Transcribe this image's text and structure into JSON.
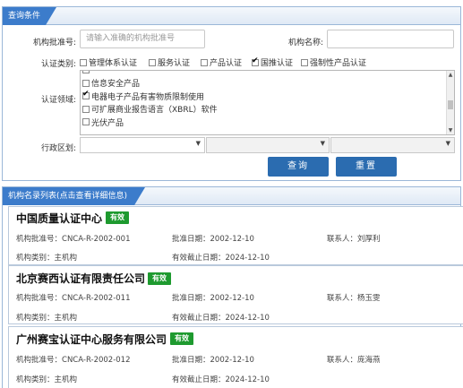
{
  "query_panel": {
    "title": "查询条件",
    "approval_no_label": "机构批准号:",
    "approval_no_placeholder": "请输入准确的机构批准号",
    "org_name_label": "机构名称:",
    "org_name_value": "",
    "cert_type_label": "认证类别:",
    "cert_types": [
      {
        "label": "管理体系认证",
        "checked": false
      },
      {
        "label": "服务认证",
        "checked": false
      },
      {
        "label": "产品认证",
        "checked": false
      },
      {
        "label": "国推认证",
        "checked": true
      },
      {
        "label": "强制性产品认证",
        "checked": false
      }
    ],
    "cert_field_label": "认证领域:",
    "cert_fields": [
      {
        "label": "信息安全产品",
        "checked": false
      },
      {
        "label": "电器电子产品有害物质限制使用",
        "checked": true
      },
      {
        "label": "可扩展商业报告语言（XBRL）软件",
        "checked": false
      },
      {
        "label": "光伏产品",
        "checked": false
      }
    ],
    "region_label": "行政区划:",
    "query_button": "查询",
    "reset_button": "重置"
  },
  "list_panel": {
    "title": "机构名录列表(点击查看详细信息)",
    "approval_no_prefix": "机构批准号：",
    "approval_date_prefix": "批准日期：",
    "contact_prefix": "联系人：",
    "org_type_prefix": "机构类别：",
    "valid_until_prefix": "有效截止日期：",
    "orgs": [
      {
        "name": "中国质量认证中心",
        "status": "有效",
        "approval_no": "CNCA-R-2002-001",
        "approval_date": "2002-12-10",
        "contact": "刘厚利",
        "org_type": "主机构",
        "valid_until": "2024-12-10"
      },
      {
        "name": "北京赛西认证有限责任公司",
        "status": "有效",
        "approval_no": "CNCA-R-2002-011",
        "approval_date": "2002-12-10",
        "contact": "杨玉雯",
        "org_type": "主机构",
        "valid_until": "2024-12-10"
      },
      {
        "name": "广州赛宝认证中心服务有限公司",
        "status": "有效",
        "approval_no": "CNCA-R-2002-012",
        "approval_date": "2002-12-10",
        "contact": "庞海燕",
        "org_type": "主机构",
        "valid_until": "2024-12-10"
      }
    ]
  },
  "colors": {
    "accent": "#3c7ccb",
    "button": "#2b6cb0",
    "badge": "#1e9a2f"
  }
}
